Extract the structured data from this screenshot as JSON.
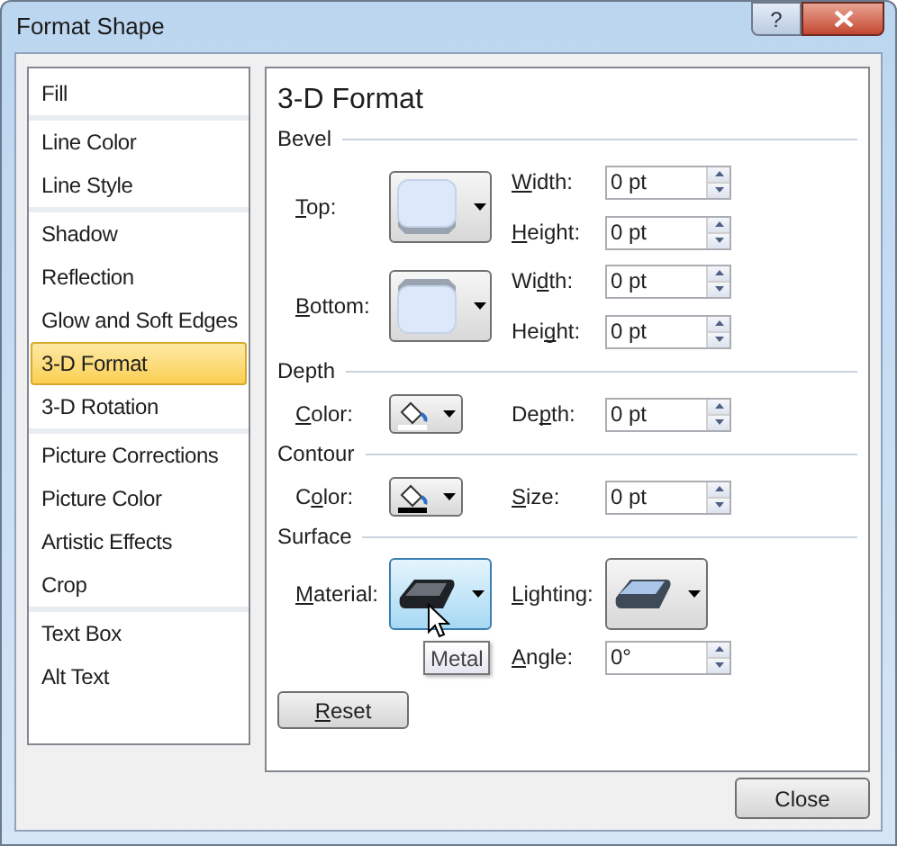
{
  "window": {
    "title": "Format Shape"
  },
  "title_buttons": [
    {
      "kind": "help",
      "label": "?"
    },
    {
      "kind": "close"
    }
  ],
  "sidebar": {
    "groups": [
      {
        "items": [
          {
            "label": "Fill",
            "selected": false
          }
        ]
      },
      {
        "items": [
          {
            "label": "Line Color",
            "selected": false
          },
          {
            "label": "Line Style",
            "selected": false
          }
        ]
      },
      {
        "items": [
          {
            "label": "Shadow",
            "selected": false
          },
          {
            "label": "Reflection",
            "selected": false
          },
          {
            "label": "Glow and Soft Edges",
            "selected": false
          },
          {
            "label": "3-D Format",
            "selected": true
          },
          {
            "label": "3-D Rotation",
            "selected": false
          }
        ]
      },
      {
        "items": [
          {
            "label": "Picture Corrections",
            "selected": false
          },
          {
            "label": "Picture Color",
            "selected": false
          },
          {
            "label": "Artistic Effects",
            "selected": false
          },
          {
            "label": "Crop",
            "selected": false
          }
        ]
      },
      {
        "items": [
          {
            "label": "Text Box",
            "selected": false
          },
          {
            "label": "Alt Text",
            "selected": false
          }
        ]
      }
    ]
  },
  "panel": {
    "title": "3-D Format",
    "sections": [
      {
        "heading": "Bevel",
        "rows": [
          {
            "label": [
              {
                "text": "T",
                "underlined": true
              },
              {
                "text": "op:",
                "underlined": false
              }
            ],
            "picker": {
              "kind": "bevel_top",
              "highlighted": false
            },
            "fields": [
              {
                "label": [
                  {
                    "text": "W",
                    "underlined": true
                  },
                  {
                    "text": "idth:",
                    "underlined": false
                  }
                ],
                "value": "0 pt"
              },
              {
                "label": [
                  {
                    "text": "H",
                    "underlined": true
                  },
                  {
                    "text": "eight:",
                    "underlined": false
                  }
                ],
                "value": "0 pt"
              }
            ]
          },
          {
            "label": [
              {
                "text": "B",
                "underlined": true
              },
              {
                "text": "ottom:",
                "underlined": false
              }
            ],
            "picker": {
              "kind": "bevel_bottom",
              "highlighted": false
            },
            "fields": [
              {
                "label": [
                  {
                    "text": "Wi",
                    "underlined": false
                  },
                  {
                    "text": "d",
                    "underlined": true
                  },
                  {
                    "text": "th:",
                    "underlined": false
                  }
                ],
                "value": "0 pt"
              },
              {
                "label": [
                  {
                    "text": "Hei",
                    "underlined": false
                  },
                  {
                    "text": "g",
                    "underlined": true
                  },
                  {
                    "text": "ht:",
                    "underlined": false
                  }
                ],
                "value": "0 pt"
              }
            ]
          }
        ]
      },
      {
        "heading": "Depth",
        "rows": [
          {
            "label": [
              {
                "text": "C",
                "underlined": true
              },
              {
                "text": "olor:",
                "underlined": false
              }
            ],
            "picker": {
              "kind": "fill_color",
              "highlighted": false,
              "color": "#ffffff"
            },
            "fields": [
              {
                "label": [
                  {
                    "text": "De",
                    "underlined": false
                  },
                  {
                    "text": "p",
                    "underlined": true
                  },
                  {
                    "text": "th:",
                    "underlined": false
                  }
                ],
                "value": "0 pt"
              }
            ]
          }
        ]
      },
      {
        "heading": "Contour",
        "rows": [
          {
            "label": [
              {
                "text": "C",
                "underlined": false
              },
              {
                "text": "o",
                "underlined": true
              },
              {
                "text": "lor:",
                "underlined": false
              }
            ],
            "picker": {
              "kind": "fill_color",
              "highlighted": false,
              "color": "#000000"
            },
            "fields": [
              {
                "label": [
                  {
                    "text": "S",
                    "underlined": true
                  },
                  {
                    "text": "ize:",
                    "underlined": false
                  }
                ],
                "value": "0 pt"
              }
            ]
          }
        ]
      },
      {
        "heading": "Surface",
        "rows": [
          {
            "label": [
              {
                "text": "M",
                "underlined": true
              },
              {
                "text": "aterial:",
                "underlined": false
              }
            ],
            "picker": {
              "kind": "material",
              "highlighted": true
            },
            "fields": [
              {
                "label": [
                  {
                    "text": "L",
                    "underlined": true
                  },
                  {
                    "text": "ighting:",
                    "underlined": false
                  }
                ],
                "picker": {
                  "kind": "lighting",
                  "highlighted": false
                }
              }
            ]
          },
          {
            "fields": [
              {
                "label": [
                  {
                    "text": "A",
                    "underlined": true
                  },
                  {
                    "text": "ngle:",
                    "underlined": false
                  }
                ],
                "value": "0°"
              }
            ]
          }
        ]
      }
    ],
    "reset_button": [
      {
        "text": "R",
        "underlined": true
      },
      {
        "text": "eset",
        "underlined": false
      }
    ]
  },
  "tooltip": {
    "text": "Metal"
  },
  "close_button": "Close"
}
